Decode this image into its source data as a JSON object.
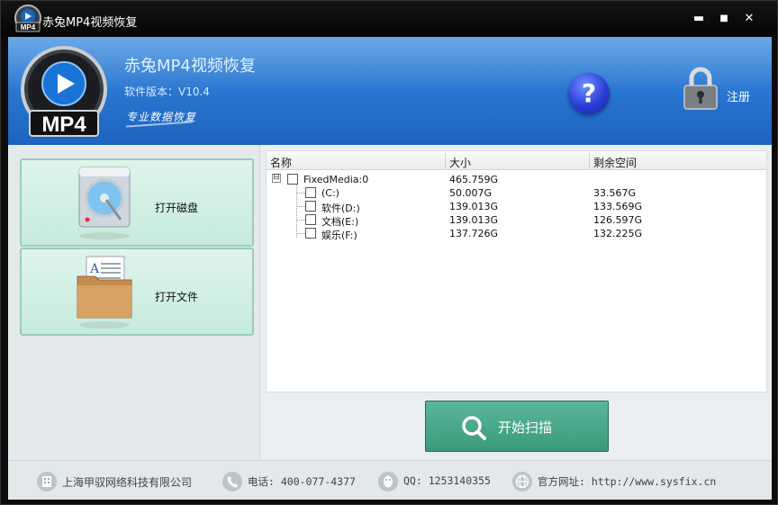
{
  "window": {
    "title": "赤兔MP4视频恢复",
    "controls": {
      "minimize": "▬",
      "maximize": "■",
      "close": "✕"
    }
  },
  "header": {
    "logo_text": "MP4",
    "app_name": "赤兔MP4视频恢复",
    "version": "软件版本：V10.4",
    "slogan": "专业数据恢复",
    "help_icon": "?",
    "register_label": "注册"
  },
  "actions": {
    "open_disk": "打开磁盘",
    "open_file": "打开文件",
    "start_scan": "开始扫描"
  },
  "file_list": {
    "columns": [
      "名称",
      "大小",
      "剩余空间"
    ],
    "root": {
      "expander": "⊟",
      "name": "FixedMedia:0",
      "size": "465.759G",
      "free": ""
    },
    "children": [
      {
        "name": "(C:)",
        "size": "50.007G",
        "free": "33.567G"
      },
      {
        "name": "软件(D:)",
        "size": "139.013G",
        "free": "133.569G"
      },
      {
        "name": "文档(E:)",
        "size": "139.013G",
        "free": "126.597G"
      },
      {
        "name": "娱乐(F:)",
        "size": "137.726G",
        "free": "132.225G"
      }
    ]
  },
  "footer": {
    "company": "上海甲驭网络科技有限公司",
    "phone": "电话: 400-077-4377",
    "qq": "QQ: 1253140355",
    "website": "官方网址: http://www.sysfix.cn"
  },
  "icons": {
    "app": "mp4-logo-icon",
    "help": "help-icon",
    "register": "lock-icon",
    "open_disk": "hard-disk-icon",
    "open_file": "folder-document-icon",
    "scan": "search-icon",
    "company": "building-icon",
    "phone": "phone-icon",
    "qq": "qq-penguin-icon",
    "website": "globe-icon"
  },
  "colors": {
    "banner_top": "#4a95e0",
    "banner_bottom": "#1c63c0",
    "action_button": "#c6ebdc",
    "scan_button": "#3b9a7c",
    "titlebar": "#0a0a0a"
  }
}
